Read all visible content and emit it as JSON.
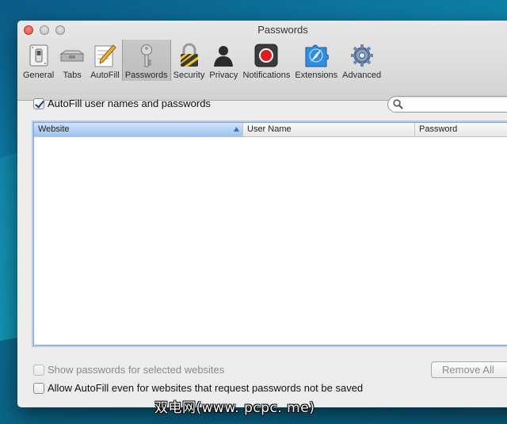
{
  "window": {
    "title": "Passwords"
  },
  "toolbar": {
    "items": [
      {
        "label": "General",
        "icon": "general-switch-icon"
      },
      {
        "label": "Tabs",
        "icon": "tabs-icon"
      },
      {
        "label": "AutoFill",
        "icon": "autofill-pencil-icon"
      },
      {
        "label": "Passwords",
        "icon": "key-icon",
        "active": true
      },
      {
        "label": "Security",
        "icon": "padlock-icon"
      },
      {
        "label": "Privacy",
        "icon": "silhouette-icon"
      },
      {
        "label": "Notifications",
        "icon": "notification-icon"
      },
      {
        "label": "Extensions",
        "icon": "puzzle-compass-icon"
      },
      {
        "label": "Advanced",
        "icon": "gear-icon"
      }
    ]
  },
  "autofill": {
    "label": "AutoFill user names and passwords",
    "checked": true
  },
  "search": {
    "placeholder": "",
    "value": ""
  },
  "table": {
    "columns": [
      "Website",
      "User Name",
      "Password"
    ],
    "sorted_column": "Website",
    "rows": []
  },
  "options": {
    "show_passwords": {
      "label": "Show passwords for selected websites",
      "checked": false,
      "disabled": true
    },
    "allow_autofill": {
      "label": "Allow AutoFill even for websites that request passwords not be saved",
      "checked": false
    }
  },
  "buttons": {
    "remove_all": "Remove All"
  },
  "watermark": "双电网(www. pcpc. me)",
  "colors": {
    "selection_blue": "#9dc3ef",
    "focus_ring": "#b5cbee",
    "close_red": "#e0443e"
  }
}
